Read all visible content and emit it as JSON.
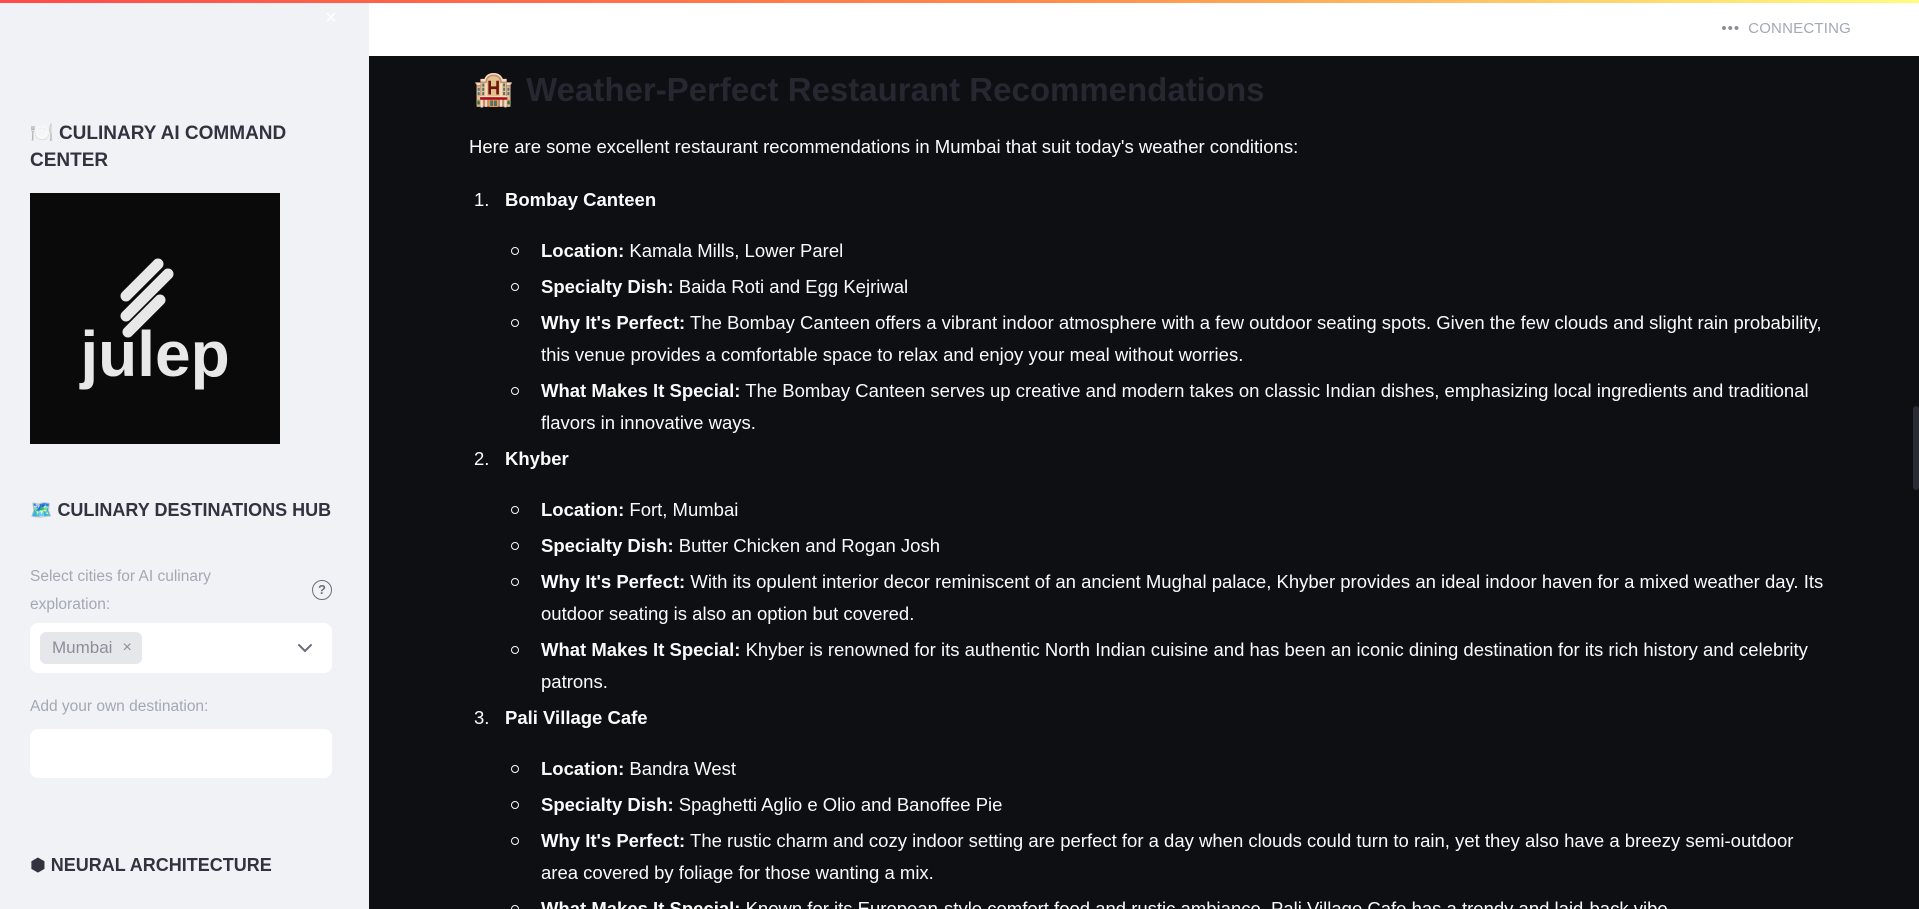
{
  "sidebar": {
    "close_label": "×",
    "title_icon": "🍽️",
    "title": "CULINARY AI COMMAND CENTER",
    "logo_text": "julep",
    "hub_icon": "🗺️",
    "hub_title": "CULINARY DESTINATIONS HUB",
    "select_label": "Select cities for AI culinary exploration:",
    "help_label": "?",
    "selected_city": "Mumbai",
    "chip_remove": "×",
    "add_label": "Add your own destination:",
    "add_value": "",
    "neural_icon": "⬢",
    "neural_title": "NEURAL ARCHITECTURE"
  },
  "header": {
    "status_dots": "•••",
    "status": "CONNECTING"
  },
  "main": {
    "heading_icon": "🏨",
    "heading": "Weather-Perfect Restaurant Recommendations",
    "intro": "Here are some excellent restaurant recommendations in Mumbai that suit today's weather conditions:",
    "restaurants": [
      {
        "num": "1.",
        "name": "Bombay Canteen",
        "items": [
          {
            "label": "Location:",
            "text": "Kamala Mills, Lower Parel"
          },
          {
            "label": "Specialty Dish:",
            "text": "Baida Roti and Egg Kejriwal"
          },
          {
            "label": "Why It's Perfect:",
            "text": "The Bombay Canteen offers a vibrant indoor atmosphere with a few outdoor seating spots. Given the few clouds and slight rain probability, this venue provides a comfortable space to relax and enjoy your meal without worries."
          },
          {
            "label": "What Makes It Special:",
            "text": "The Bombay Canteen serves up creative and modern takes on classic Indian dishes, emphasizing local ingredients and traditional flavors in innovative ways."
          }
        ]
      },
      {
        "num": "2.",
        "name": "Khyber",
        "items": [
          {
            "label": "Location:",
            "text": "Fort, Mumbai"
          },
          {
            "label": "Specialty Dish:",
            "text": "Butter Chicken and Rogan Josh"
          },
          {
            "label": "Why It's Perfect:",
            "text": "With its opulent interior decor reminiscent of an ancient Mughal palace, Khyber provides an ideal indoor haven for a mixed weather day. Its outdoor seating is also an option but covered."
          },
          {
            "label": "What Makes It Special:",
            "text": "Khyber is renowned for its authentic North Indian cuisine and has been an iconic dining destination for its rich history and celebrity patrons."
          }
        ]
      },
      {
        "num": "3.",
        "name": "Pali Village Cafe",
        "items": [
          {
            "label": "Location:",
            "text": "Bandra West"
          },
          {
            "label": "Specialty Dish:",
            "text": "Spaghetti Aglio e Olio and Banoffee Pie"
          },
          {
            "label": "Why It's Perfect:",
            "text": "The rustic charm and cozy indoor setting are perfect for a day when clouds could turn to rain, yet they also have a breezy semi-outdoor area covered by foliage for those wanting a mix."
          },
          {
            "label": "What Makes It Special:",
            "text": "Known for its European-style comfort food and rustic ambiance, Pali Village Cafe has a trendy and laid-back vibe."
          }
        ]
      }
    ]
  }
}
